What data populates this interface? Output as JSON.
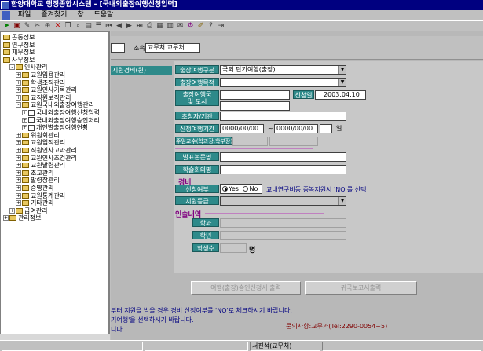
{
  "window": {
    "title": "한양대학교 행정종합시스템 - [국내외출장여행신청입력]"
  },
  "menu": [
    "파일",
    "즐겨찾기",
    "창",
    "도움말"
  ],
  "tree": [
    {
      "label": "공통정보",
      "depth": 0,
      "type": "folder",
      "pm": ""
    },
    {
      "label": "연구정보",
      "depth": 0,
      "type": "folder",
      "pm": ""
    },
    {
      "label": "재무정보",
      "depth": 0,
      "type": "folder",
      "pm": ""
    },
    {
      "label": "사무정보",
      "depth": 0,
      "type": "folder",
      "pm": ""
    },
    {
      "label": "인사관리",
      "depth": 1,
      "type": "folder",
      "pm": "-"
    },
    {
      "label": "교원임용관리",
      "depth": 2,
      "type": "folder",
      "pm": "+"
    },
    {
      "label": "학생조직관리",
      "depth": 2,
      "type": "folder",
      "pm": "+"
    },
    {
      "label": "교원인사기록관리",
      "depth": 2,
      "type": "folder",
      "pm": "+"
    },
    {
      "label": "교직원보직관리",
      "depth": 2,
      "type": "folder",
      "pm": "+"
    },
    {
      "label": "교원국내외출장여행관리",
      "depth": 2,
      "type": "folder",
      "pm": "-"
    },
    {
      "label": "국내외출장여행신청입력",
      "depth": 3,
      "type": "doc",
      "pm": "+"
    },
    {
      "label": "국내외출장여행승인처리",
      "depth": 3,
      "type": "doc",
      "pm": "+"
    },
    {
      "label": "개인별출장여행현황",
      "depth": 3,
      "type": "doc",
      "pm": "+"
    },
    {
      "label": "위원회관리",
      "depth": 2,
      "type": "folder",
      "pm": "+"
    },
    {
      "label": "교원업적관리",
      "depth": 2,
      "type": "folder",
      "pm": "+"
    },
    {
      "label": "직원인사고과관리",
      "depth": 2,
      "type": "folder",
      "pm": "+"
    },
    {
      "label": "교원인사조건관리",
      "depth": 2,
      "type": "folder",
      "pm": "+"
    },
    {
      "label": "교원발령관리",
      "depth": 2,
      "type": "folder",
      "pm": "+"
    },
    {
      "label": "조교관리",
      "depth": 2,
      "type": "folder",
      "pm": "+"
    },
    {
      "label": "발령장관리",
      "depth": 2,
      "type": "folder",
      "pm": "+"
    },
    {
      "label": "증명관리",
      "depth": 2,
      "type": "folder",
      "pm": "+"
    },
    {
      "label": "교원통계관리",
      "depth": 2,
      "type": "folder",
      "pm": "+"
    },
    {
      "label": "기타관리",
      "depth": 2,
      "type": "folder",
      "pm": "+"
    },
    {
      "label": "급여관리",
      "depth": 1,
      "type": "folder",
      "pm": "+"
    },
    {
      "label": "관리정보",
      "depth": 0,
      "type": "folder",
      "pm": "+"
    }
  ],
  "header": {
    "affiliation_label": "소속",
    "affiliation_value": "교무처 교무처"
  },
  "left_label": "지원경비(원)",
  "form": {
    "trip_type_label": "출장여행구분",
    "trip_type_value": "국외 단기여행(출장)",
    "purpose_label": "출장여행목적",
    "purpose_value": "",
    "dest_label": "출장여행국\n및 도시",
    "apply_date_label": "신청일",
    "apply_date_value": "2003.04.10",
    "inviter_label": "초청자/기관",
    "period_label": "신청여행기간",
    "period_from": "0000/00/00",
    "period_to": "0000/00/00",
    "period_sep": "~",
    "period_unit": "일",
    "main_prof_label": "주임교수(학과장,학부장)",
    "paper_label": "발표논문명",
    "conf_label": "학술회의명",
    "expense_section": "경비",
    "apply_yn_label": "신청여부",
    "yes_label": "Yes",
    "no_label": "No",
    "apply_note": "교내연구비등 중복지원시 'NO'를 선택",
    "support_label": "지원등급",
    "escort_section": "인솔내역",
    "dept_label": "학과",
    "grade_label": "학년",
    "count_label": "학생수",
    "count_unit": "명"
  },
  "buttons": {
    "print_apply": "여행(출장)승인신청서 출력",
    "report_write": "귀국보고서출력"
  },
  "notices": {
    "line1": "부터 지원을 받을 경우 경비 신청여부를 'NO'로 체크하시기 바랍니다.",
    "line2": "기여행'을 선택하시기 바랍니다.",
    "line3": "니다.",
    "contact": "문의사항:교무과(Tel:2290-0054~5)"
  },
  "status": {
    "user": "서진석(교무처)"
  }
}
